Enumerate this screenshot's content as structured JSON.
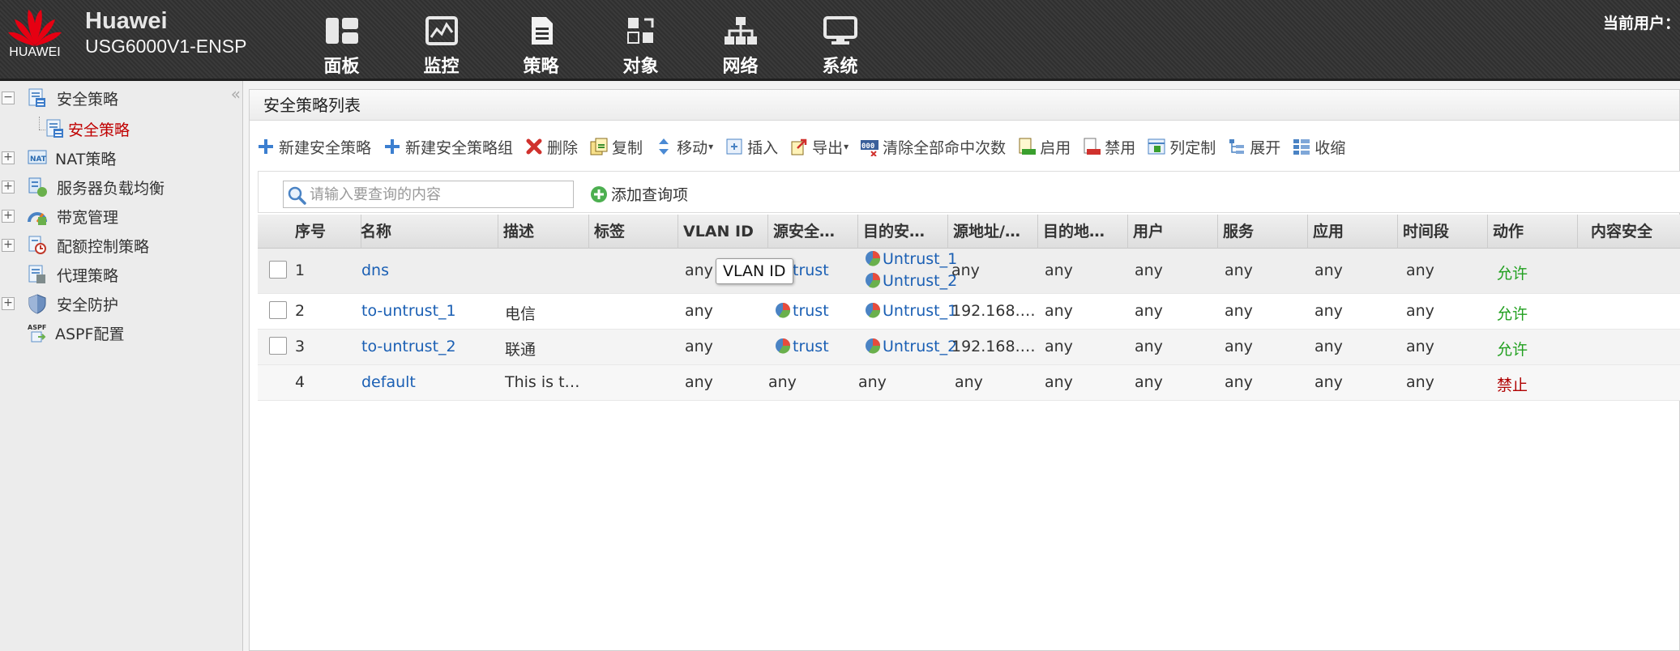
{
  "header": {
    "logo_text": "HUAWEI",
    "brand": "Huawei",
    "model": "USG6000V1-ENSP",
    "current_user_label": "当前用户：",
    "nav": [
      {
        "label": "面板",
        "icon": "dashboard-icon"
      },
      {
        "label": "监控",
        "icon": "monitor-icon"
      },
      {
        "label": "策略",
        "icon": "policy-icon"
      },
      {
        "label": "对象",
        "icon": "object-icon"
      },
      {
        "label": "网络",
        "icon": "network-icon"
      },
      {
        "label": "系统",
        "icon": "system-icon"
      }
    ]
  },
  "sidebar": {
    "items": [
      {
        "label": "安全策略",
        "expander": "−"
      },
      {
        "label": "安全策略",
        "selected": true
      },
      {
        "label": "NAT策略",
        "expander": "+"
      },
      {
        "label": "服务器负载均衡",
        "expander": "+"
      },
      {
        "label": "带宽管理",
        "expander": "+"
      },
      {
        "label": "配额控制策略",
        "expander": "+"
      },
      {
        "label": "代理策略"
      },
      {
        "label": "安全防护",
        "expander": "+"
      },
      {
        "label": "ASPF配置"
      }
    ]
  },
  "main": {
    "title": "安全策略列表",
    "toolbar": [
      {
        "label": "新建安全策略",
        "icon": "plus-icon"
      },
      {
        "label": "新建安全策略组",
        "icon": "plus-icon"
      },
      {
        "label": "删除",
        "icon": "delete-icon"
      },
      {
        "label": "复制",
        "icon": "copy-icon"
      },
      {
        "label": "移动",
        "icon": "move-icon",
        "caret": "▾"
      },
      {
        "label": "插入",
        "icon": "insert-icon"
      },
      {
        "label": "导出",
        "icon": "export-icon",
        "caret": "▾"
      },
      {
        "label": "清除全部命中次数",
        "icon": "clear-hits-icon"
      },
      {
        "label": "启用",
        "icon": "enable-icon"
      },
      {
        "label": "禁用",
        "icon": "disable-icon"
      },
      {
        "label": "列定制",
        "icon": "column-custom-icon"
      },
      {
        "label": "展开",
        "icon": "expand-icon"
      },
      {
        "label": "收缩",
        "icon": "collapse-icon"
      }
    ],
    "search": {
      "placeholder": "请输入要查询的内容",
      "add_query_label": "添加查询项"
    },
    "tooltip": "VLAN ID",
    "columns": [
      "序号",
      "名称",
      "描述",
      "标签",
      "VLAN ID",
      "源安全…",
      "目的安…",
      "源地址/…",
      "目的地…",
      "用户",
      "服务",
      "应用",
      "时间段",
      "动作",
      "内容安全"
    ],
    "rows": [
      {
        "no": "1",
        "name": "dns",
        "desc": "",
        "tag": "",
        "vlan": "any",
        "src_zone": "trust",
        "dst_zone": [
          "Untrust_1",
          "Untrust_2"
        ],
        "src_addr": "any",
        "dst_addr": "any",
        "user": "any",
        "service": "any",
        "app": "any",
        "time": "any",
        "action": "允许"
      },
      {
        "no": "2",
        "name": "to-untrust_1",
        "desc": "电信",
        "tag": "",
        "vlan": "any",
        "src_zone": "trust",
        "dst_zone": [
          "Untrust_1"
        ],
        "src_addr": "192.168.…",
        "dst_addr": "any",
        "user": "any",
        "service": "any",
        "app": "any",
        "time": "any",
        "action": "允许"
      },
      {
        "no": "3",
        "name": "to-untrust_2",
        "desc": "联通",
        "tag": "",
        "vlan": "any",
        "src_zone": "trust",
        "dst_zone": [
          "Untrust_2"
        ],
        "src_addr": "192.168.…",
        "dst_addr": "any",
        "user": "any",
        "service": "any",
        "app": "any",
        "time": "any",
        "action": "允许"
      },
      {
        "no": "4",
        "name": "default",
        "desc": "This is t…",
        "tag": "",
        "vlan": "any",
        "src_zone": "any",
        "dst_zone": [
          "any"
        ],
        "src_addr": "any",
        "dst_addr": "any",
        "user": "any",
        "service": "any",
        "app": "any",
        "time": "any",
        "action": "禁止"
      }
    ]
  },
  "colors": {
    "link": "#1a5fb4",
    "allow": "#22a020",
    "deny": "#b00000",
    "selected": "#c00000"
  }
}
